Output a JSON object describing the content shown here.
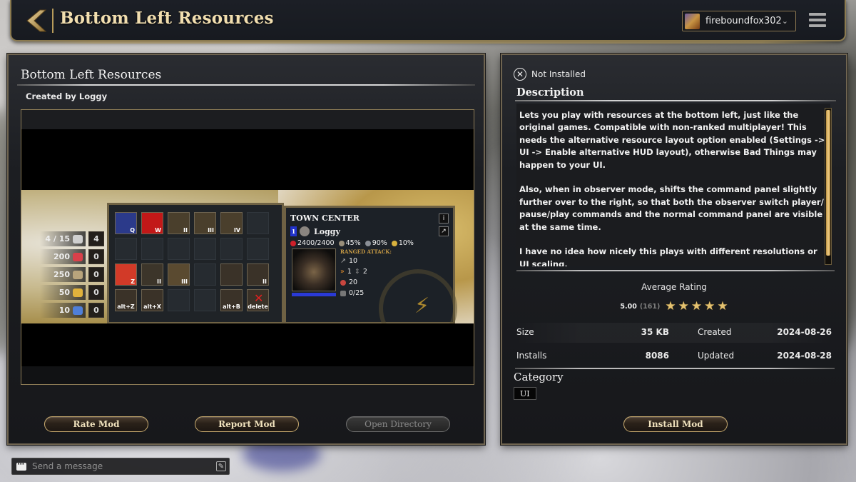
{
  "header": {
    "title": "Bottom Left Resources",
    "username": "fireboundfox302"
  },
  "mod": {
    "title": "Bottom Left Resources",
    "created_by": "Created by Loggy",
    "preview": {
      "resources": [
        {
          "value": "4 / 15",
          "icon": "house-icon",
          "count": "4",
          "color": "#cfcfcf"
        },
        {
          "value": "200",
          "icon": "food-icon",
          "count": "0",
          "color": "#d9404a"
        },
        {
          "value": "250",
          "icon": "wood-icon",
          "count": "0",
          "color": "#b8a47c"
        },
        {
          "value": "50",
          "icon": "gold-icon",
          "count": "0",
          "color": "#e0b23c"
        },
        {
          "value": "10",
          "icon": "favor-icon",
          "count": "0",
          "color": "#4f7fd8"
        }
      ],
      "command_hotkeys": {
        "row1": [
          "Q",
          "W",
          "II",
          "III",
          "IV"
        ],
        "row3": [
          "Z",
          "II",
          "III",
          "",
          "",
          "II"
        ],
        "row4": [
          "alt+Z",
          "alt+X",
          "",
          "",
          "alt+B",
          "delete"
        ]
      },
      "unit": {
        "name": "TOWN CENTER",
        "player_number": "1",
        "owner": "Loggy",
        "hp": "2400/2400",
        "armor_hack": "45%",
        "armor_pierce": "90%",
        "armor_crush": "10%",
        "attack_label": "RANGED ATTACK:",
        "damage": "10",
        "rate": "1",
        "range": "2",
        "range_value": "20",
        "garrison": "0/25"
      }
    },
    "buttons": {
      "rate": "Rate Mod",
      "report": "Report Mod",
      "open_directory": "Open Directory",
      "install": "Install Mod"
    }
  },
  "details": {
    "status": "Not Installed",
    "description_heading": "Description",
    "description": [
      "Lets you play with resources at the bottom left, just like the original games. Compatible with non-ranked multiplayer! This needs the alternative resource layout option enabled (Settings -> UI -> Enable alternative HUD layout), otherwise Bad Things may happen to your UI.",
      "Also, when in observer mode, shifts the command panel slightly further over to the right, so that both the observer switch player/ pause/play commands and the normal command panel are visible at the same time.",
      "I have no idea how nicely this plays with different resolutions or UI scaling."
    ],
    "rating_label": "Average Rating",
    "rating_value": "5.00",
    "rating_count": "(161)",
    "rating_stars": 5,
    "rating_max": 5,
    "size_label": "Size",
    "size_value": "35 KB",
    "created_label": "Created",
    "created_value": "2024-08-26",
    "installs_label": "Installs",
    "installs_value": "8086",
    "updated_label": "Updated",
    "updated_value": "2024-08-28",
    "category_heading": "Category",
    "category": "UI"
  },
  "chat": {
    "placeholder": "Send a message"
  },
  "colors": {
    "accent_gold": "#c9ab6f",
    "title_gold": "#f1deaf",
    "star": "#e5c270"
  }
}
